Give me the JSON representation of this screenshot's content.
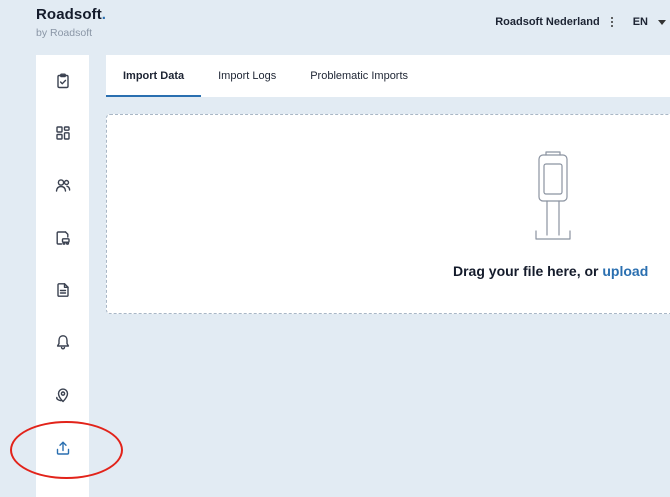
{
  "brand": {
    "name": "Roadsoft",
    "dot": ".",
    "sub": "by Roadsoft"
  },
  "header": {
    "org": "Roadsoft Nederland",
    "lang": "EN"
  },
  "sidebar": {
    "items": [
      {
        "icon": "clipboard-check-icon"
      },
      {
        "icon": "dashboard-grid-icon"
      },
      {
        "icon": "users-icon"
      },
      {
        "icon": "vehicle-document-icon"
      },
      {
        "icon": "document-icon"
      },
      {
        "icon": "bell-icon"
      },
      {
        "icon": "location-pin-icon"
      },
      {
        "icon": "upload-icon",
        "active": true
      }
    ]
  },
  "tabs": [
    {
      "label": "Import Data",
      "active": true
    },
    {
      "label": "Import Logs"
    },
    {
      "label": "Problematic Imports"
    }
  ],
  "dropzone": {
    "text": "Drag your file here, or ",
    "link": "upload"
  },
  "colors": {
    "accent": "#2a6fb0",
    "background": "#e2ebf3",
    "annotation": "#e2231a"
  }
}
